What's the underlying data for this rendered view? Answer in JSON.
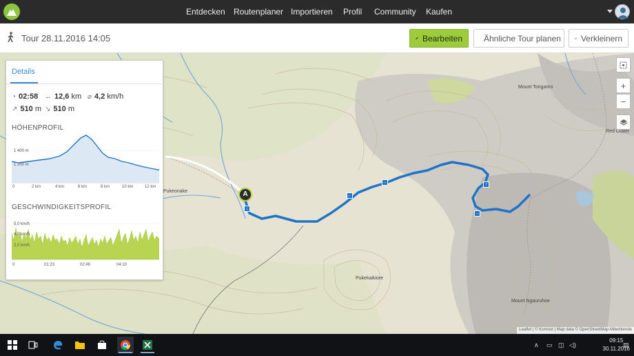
{
  "nav": {
    "items": [
      "Entdecken",
      "Routenplaner",
      "Importieren",
      "Profil",
      "Community",
      "Kaufen"
    ]
  },
  "tour": {
    "title": "Tour 28.11.2016 14:05",
    "edit_label": "Bearbeiten",
    "plan_label": "Ähnliche Tour planen",
    "shrink_label": "Verkleinern"
  },
  "details": {
    "tab": "Details",
    "duration": "02:58",
    "distance": "12,6",
    "distance_unit": "km",
    "avg_speed": "4,2",
    "speed_unit": "km/h",
    "ascent": "510",
    "descent": "510",
    "elev_unit": "m",
    "elevation_title": "HÖHENPROFIL",
    "elev_y": [
      "1 400 m",
      "1 200 m"
    ],
    "elev_x": [
      "0",
      "2 km",
      "4 km",
      "6 km",
      "8 km",
      "10 km",
      "12 km"
    ],
    "speed_title": "GESCHWINDIGKEITSPROFIL",
    "speed_y": [
      "5,0 km/h",
      "4,0 km/h",
      "2,0 km/h"
    ],
    "speed_x": [
      "0",
      "01:23",
      "02:46",
      "04:10"
    ]
  },
  "map": {
    "labels": {
      "mount_tongariro": "Mount Tongariro",
      "red_crater": "Red Crater",
      "pukeonake": "Pukeonake",
      "pukekaikiore": "Pukekaikiore",
      "mount_ngauruhoe": "Mount Ngauruhoe"
    },
    "start_marker": "A",
    "zoom_in": "+",
    "zoom_out": "−",
    "attribution": "Leaflet | © Komoot | Map data © OpenStreetMap-Mitwirkende"
  },
  "taskbar": {
    "time": "09:15",
    "date": "30.11.2016"
  },
  "colors": {
    "accent": "#9ccb3b",
    "route": "#1e73c8",
    "topbar": "#2b2b2b"
  }
}
